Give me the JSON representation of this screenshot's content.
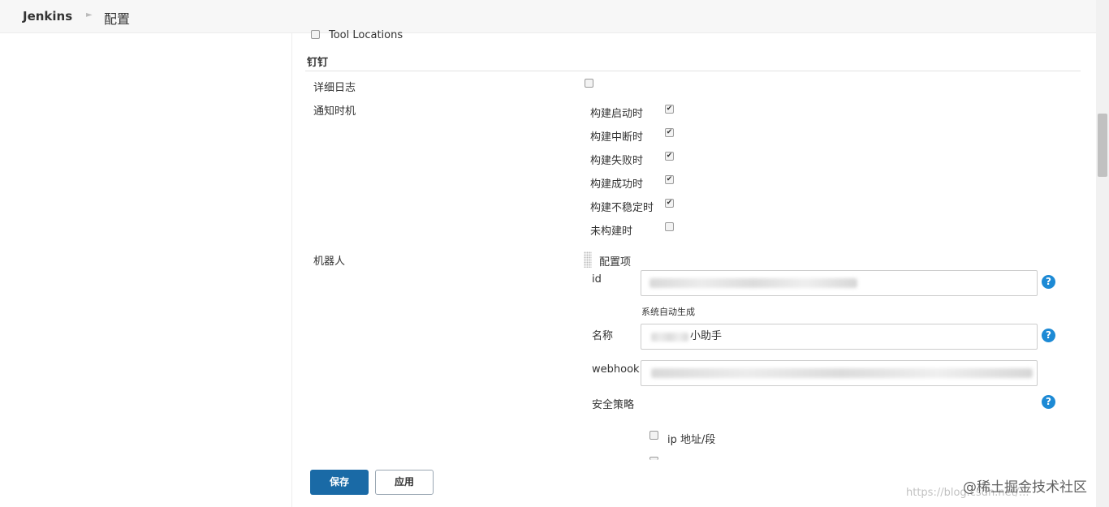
{
  "header": {
    "brand": "Jenkins",
    "breadcrumb": "配置"
  },
  "tool_locations": {
    "label": "Tool Locations",
    "checked": false
  },
  "section": {
    "title": "钉钉"
  },
  "verbose_log": {
    "label": "详细日志",
    "checked": false
  },
  "notify": {
    "label": "通知时机",
    "options": [
      {
        "label": "构建启动时",
        "checked": true
      },
      {
        "label": "构建中断时",
        "checked": true
      },
      {
        "label": "构建失败时",
        "checked": true
      },
      {
        "label": "构建成功时",
        "checked": true
      },
      {
        "label": "构建不稳定时",
        "checked": true
      },
      {
        "label": "未构建时",
        "checked": false
      }
    ]
  },
  "robot": {
    "label": "机器人",
    "config_label": "配置项",
    "id_label": "id",
    "id_hint": "系统自动生成",
    "name_label": "名称",
    "name_value": "小助手",
    "webhook_label": "webhook",
    "security_label": "安全策略",
    "ip_label": "ip 地址/段",
    "help_icon": "?"
  },
  "buttons": {
    "save": "保存",
    "apply": "应用"
  },
  "watermark": {
    "brand": "@稀土掘金技术社区",
    "url": "https://blog.csdn.net/..."
  }
}
